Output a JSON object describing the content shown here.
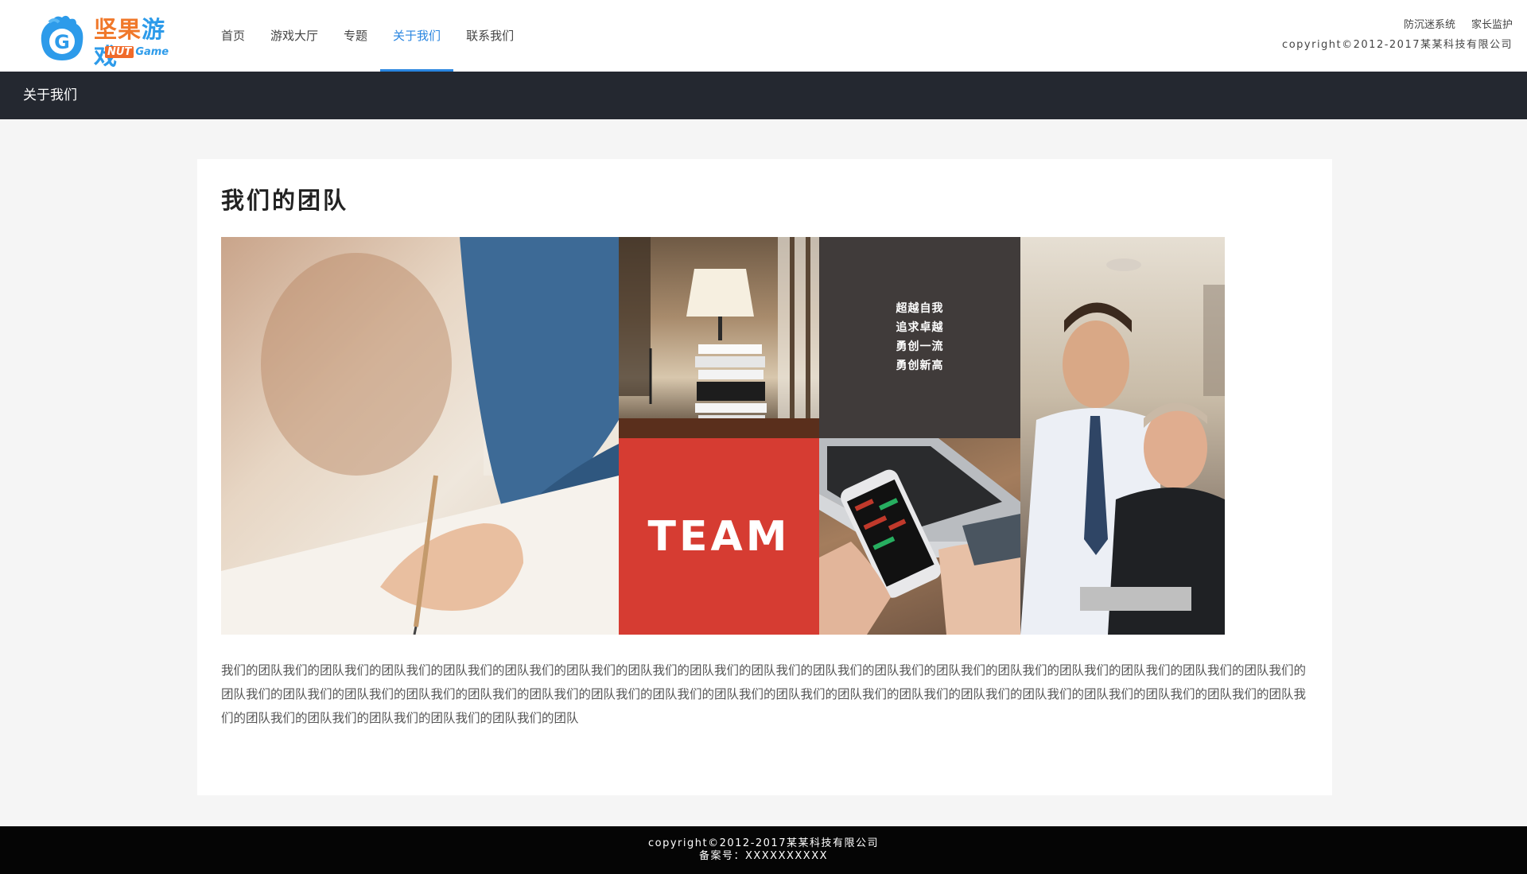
{
  "logo": {
    "title_part1": "坚果",
    "title_part2": "游戏",
    "sub_part1": "NUT",
    "sub_part2": "Game",
    "badge_letter": "G",
    "colors": {
      "orange": "#f0782a",
      "blue": "#2d9bea"
    }
  },
  "nav": {
    "items": [
      {
        "label": "首页",
        "active": false
      },
      {
        "label": "游戏大厅",
        "active": false
      },
      {
        "label": "专题",
        "active": false
      },
      {
        "label": "关于我们",
        "active": true
      },
      {
        "label": "联系我们",
        "active": false
      }
    ],
    "accent_color": "#2a86e0"
  },
  "top_links": {
    "anti_addiction": "防沉迷系统",
    "parental": "家长监护",
    "copyright": "copyright©2012-2017某某科技有限公司"
  },
  "title_bar": {
    "text": "关于我们",
    "color": "#242830"
  },
  "card": {
    "title": "我们的团队",
    "collage": {
      "slogan_lines": [
        "超越自我",
        "追求卓越",
        "勇创一流",
        "勇创新高"
      ],
      "team_text": "TEAM",
      "team_color": "#d63c32",
      "slogan_bg": "#403b3a"
    },
    "body": "我们的团队我们的团队我们的团队我们的团队我们的团队我们的团队我们的团队我们的团队我们的团队我们的团队我们的团队我们的团队我们的团队我们的团队我们的团队我们的团队我们的团队我们的团队我们的团队我们的团队我们的团队我们的团队我们的团队我们的团队我们的团队我们的团队我们的团队我们的团队我们的团队我们的团队我们的团队我们的团队我们的团队我们的团队我们的团队我们的团队我们的团队我们的团队我们的团队我们的团队我们的团队"
  },
  "footer": {
    "copyright": "copyright©2012-2017某某科技有限公司",
    "icp": "备案号：XXXXXXXXXX"
  }
}
